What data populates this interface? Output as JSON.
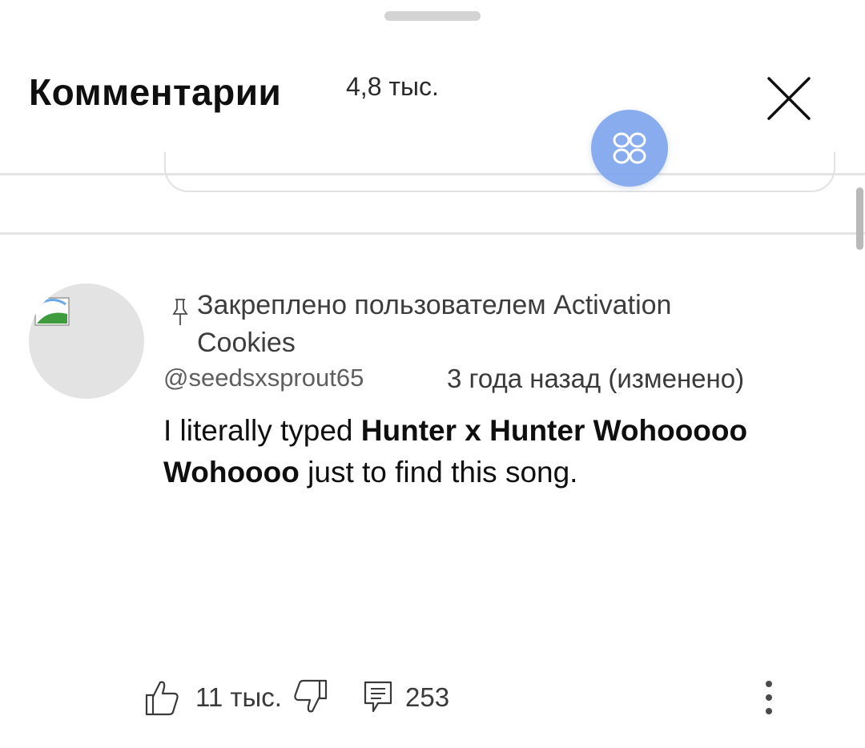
{
  "header": {
    "title": "Комментарии",
    "count": "4,8 тыс."
  },
  "icons": {
    "close": "close-icon",
    "floating": "four-leaf-menu-icon",
    "pin": "pin-icon",
    "like": "thumbs-up-icon",
    "dislike": "thumbs-down-icon",
    "reply": "reply-icon",
    "more": "more-vertical-icon"
  },
  "colors": {
    "floating_button": "#7fa6ee",
    "text_primary": "#0f0f0f",
    "text_secondary": "#5e5e5e"
  },
  "comment": {
    "pinned_label": "Закреплено пользователем Activation Cookies",
    "author": "@seedsxsprout65",
    "meta": "3 года назад (изменено)",
    "text_part1": "I literally typed ",
    "text_highlight1": "Hunter x Hunter Wohooooo Wohoooo",
    "text_part2": " just to find this song.",
    "likes": "11 тыс.",
    "replies": "253"
  }
}
